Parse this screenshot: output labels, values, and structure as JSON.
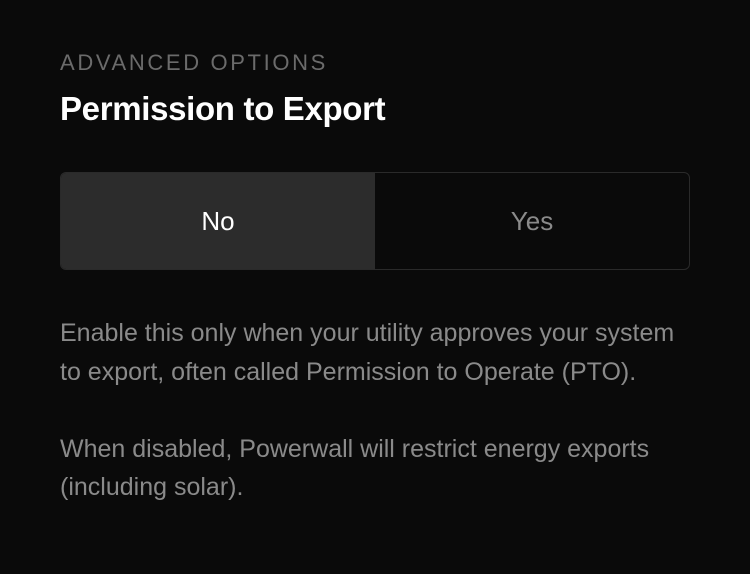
{
  "section": {
    "label": "ADVANCED OPTIONS",
    "title": "Permission to Export"
  },
  "toggle": {
    "options": {
      "no": "No",
      "yes": "Yes"
    },
    "selected": "no"
  },
  "description": {
    "paragraph1": "Enable this only when your utility approves your system to export, often called Permission to Operate (PTO).",
    "paragraph2": "When disabled, Powerwall will restrict energy exports (including solar)."
  }
}
